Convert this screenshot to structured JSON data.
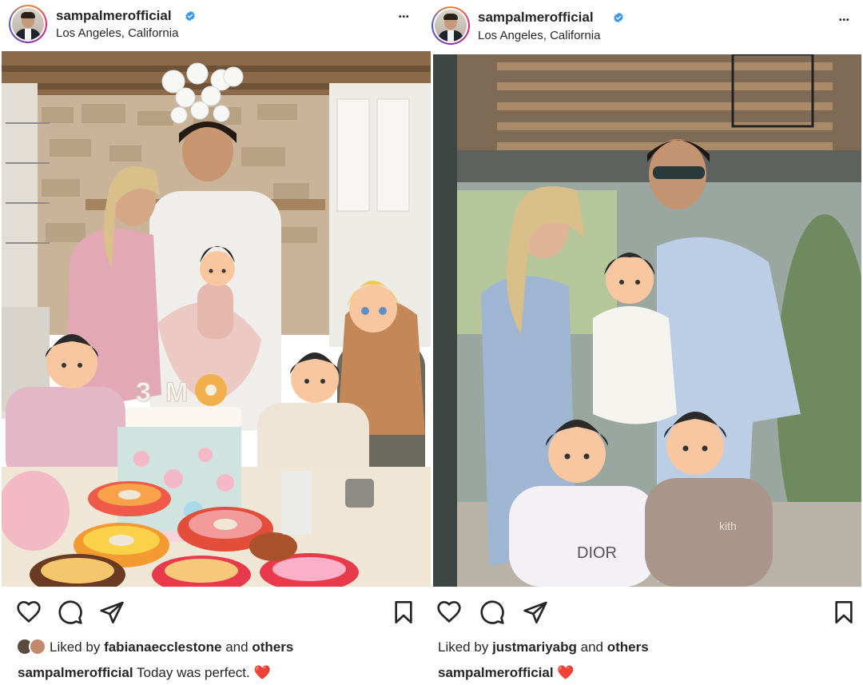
{
  "posts": [
    {
      "username": "sampalmerofficial",
      "location": "Los Angeles, California",
      "more_label": "•••",
      "likes": {
        "prefix": "Liked by",
        "user": "fabianaecclestone",
        "joiner": "and",
        "suffix": "others"
      },
      "caption": {
        "user": "sampalmerofficial",
        "text": "Today was perfect.",
        "emoji": "❤️"
      },
      "photo_scene": "birthday-kitchen",
      "cake_topper": "3 M"
    },
    {
      "username": "sampalmerofficial",
      "location": "Los Angeles, California",
      "more_label": "•••",
      "likes": {
        "prefix": "Liked by",
        "user": "justmariyabg",
        "joiner": "and",
        "suffix": "others"
      },
      "caption": {
        "user": "sampalmerofficial",
        "text": "",
        "emoji": "❤️"
      },
      "photo_scene": "family-patio",
      "shirt_text": "DIOR",
      "shirt_text_2": "kith"
    }
  ],
  "colors": {
    "verified": "#3897f0",
    "text": "#262626",
    "heart": "#e0242c"
  },
  "icons": [
    "heart-icon",
    "comment-icon",
    "share-icon",
    "bookmark-icon",
    "verified-badge-icon",
    "more-options-icon"
  ]
}
